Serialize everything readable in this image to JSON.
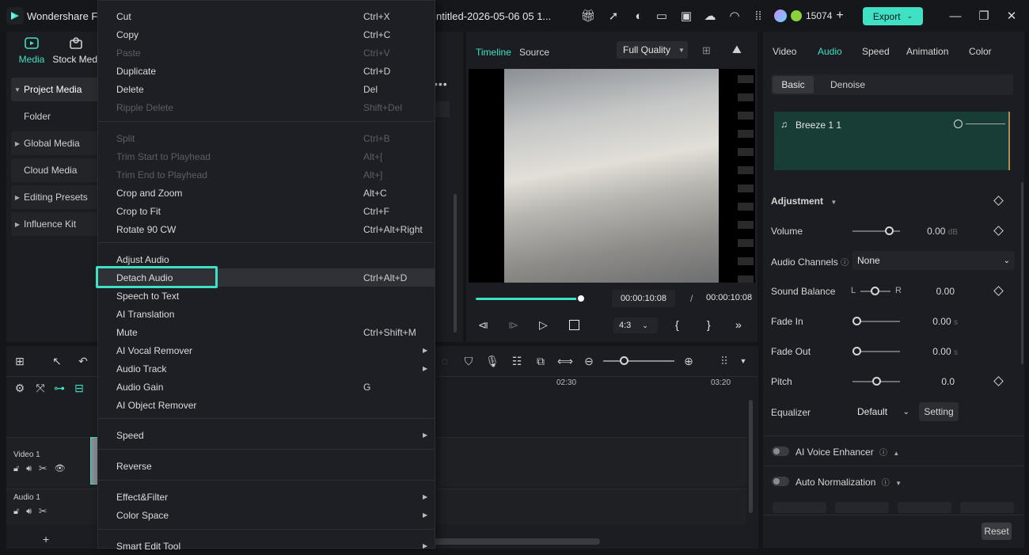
{
  "app": {
    "title": "Wondershare Film",
    "project_name": "ntitled-2026-05-06 05 1...",
    "credits": "15074",
    "export_label": "Export"
  },
  "media_tabs": [
    {
      "label": "Media"
    },
    {
      "label": "Stock Medi"
    }
  ],
  "left_nav": [
    {
      "label": "Project Media"
    },
    {
      "label": "Folder"
    },
    {
      "label": "Global Media"
    },
    {
      "label": "Cloud Media"
    },
    {
      "label": "Editing Presets"
    },
    {
      "label": "Influence Kit"
    }
  ],
  "context_menu": {
    "items": [
      {
        "label": "Cut",
        "shortcut": "Ctrl+X"
      },
      {
        "label": "Copy",
        "shortcut": "Ctrl+C"
      },
      {
        "label": "Paste",
        "shortcut": "Ctrl+V"
      },
      {
        "label": "Duplicate",
        "shortcut": "Ctrl+D"
      },
      {
        "label": "Delete",
        "shortcut": "Del"
      },
      {
        "label": "Ripple Delete",
        "shortcut": "Shift+Del"
      },
      {
        "label": "Split",
        "shortcut": "Ctrl+B"
      },
      {
        "label": "Trim Start to Playhead",
        "shortcut": "Alt+["
      },
      {
        "label": "Trim End to Playhead",
        "shortcut": "Alt+]"
      },
      {
        "label": "Crop and Zoom",
        "shortcut": "Alt+C"
      },
      {
        "label": "Crop to Fit",
        "shortcut": "Ctrl+F"
      },
      {
        "label": "Rotate 90 CW",
        "shortcut": "Ctrl+Alt+Right"
      },
      {
        "label": "Adjust Audio",
        "shortcut": ""
      },
      {
        "label": "Detach Audio",
        "shortcut": "Ctrl+Alt+D"
      },
      {
        "label": "Speech to Text",
        "shortcut": ""
      },
      {
        "label": "AI Translation",
        "shortcut": ""
      },
      {
        "label": "Mute",
        "shortcut": "Ctrl+Shift+M"
      },
      {
        "label": "AI Vocal Remover",
        "shortcut": ""
      },
      {
        "label": "Audio Track",
        "shortcut": ""
      },
      {
        "label": "Audio Gain",
        "shortcut": "G"
      },
      {
        "label": "AI Object Remover",
        "shortcut": ""
      },
      {
        "label": "Speed",
        "shortcut": ""
      },
      {
        "label": "Reverse",
        "shortcut": ""
      },
      {
        "label": "Effect&Filter",
        "shortcut": ""
      },
      {
        "label": "Color Space",
        "shortcut": ""
      },
      {
        "label": "Smart Edit Tool",
        "shortcut": ""
      }
    ]
  },
  "viewer": {
    "tabs": [
      "Timeline",
      "Source"
    ],
    "quality": "Full Quality",
    "current_time": "00:00:10:08",
    "separator": "/",
    "total_time": "00:00:10:08",
    "aspect": "4:3",
    "progress": 1.0
  },
  "properties": {
    "tabs": [
      "Video",
      "Audio",
      "Speed",
      "Animation",
      "Color"
    ],
    "subtabs": [
      "Basic",
      "Denoise"
    ],
    "clip_name": "Breeze 1 1",
    "section_adjustment": "Adjustment",
    "volume_label": "Volume",
    "volume_value": "0.00",
    "volume_unit": "dB",
    "channels_label": "Audio Channels",
    "channels_value": "None",
    "balance_label": "Sound Balance",
    "balance_l": "L",
    "balance_r": "R",
    "balance_value": "0.00",
    "fadein_label": "Fade In",
    "fadein_value": "0.00",
    "fadein_unit": "s",
    "fadeout_label": "Fade Out",
    "fadeout_value": "0.00",
    "fadeout_unit": "s",
    "pitch_label": "Pitch",
    "pitch_value": "0.0",
    "eq_label": "Equalizer",
    "eq_value": "Default",
    "eq_setting": "Setting",
    "ai_voice": "AI Voice Enhancer",
    "auto_norm": "Auto Normalization",
    "reset": "Reset"
  },
  "timeline": {
    "ruler": [
      "02:30",
      "03:20"
    ],
    "tracks": [
      {
        "label": "Video 1"
      },
      {
        "label": "Audio 1"
      }
    ],
    "add": "+"
  },
  "colors": {
    "accent": "#3fe0c3"
  }
}
